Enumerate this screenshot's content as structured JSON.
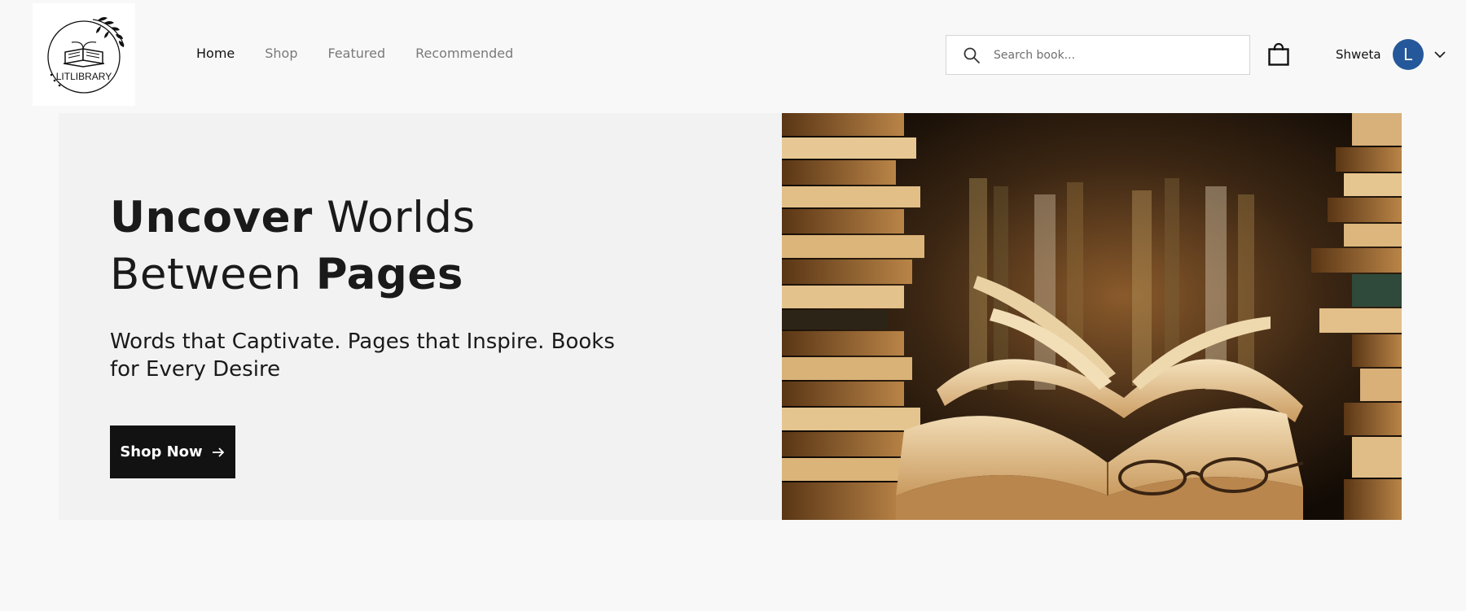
{
  "brand": {
    "logo_text": "LITLIBRARY"
  },
  "nav": {
    "items": [
      {
        "label": "Home",
        "active": true
      },
      {
        "label": "Shop",
        "active": false
      },
      {
        "label": "Featured",
        "active": false
      },
      {
        "label": "Recommended",
        "active": false
      }
    ]
  },
  "search": {
    "placeholder": "Search book...",
    "value": "",
    "icon": "search-icon"
  },
  "cart": {
    "icon": "shopping-bag-icon"
  },
  "user": {
    "name": "Shweta",
    "initial": "L",
    "avatar_color": "#24589a",
    "menu_icon": "chevron-down-icon"
  },
  "hero": {
    "title_bold_1": "Uncover",
    "title_rest_1": " Worlds",
    "title_rest_2": "Between ",
    "title_bold_2": "Pages",
    "subtitle": "Words that Captivate. Pages that Inspire. Books for Every Desire",
    "cta_label": "Shop Now",
    "cta_icon": "arrow-right-icon",
    "image": "books-with-glasses-photo"
  },
  "colors": {
    "page_bg": "#f8f8f8",
    "hero_bg": "#f2f2f2",
    "cta_bg": "#121212"
  }
}
